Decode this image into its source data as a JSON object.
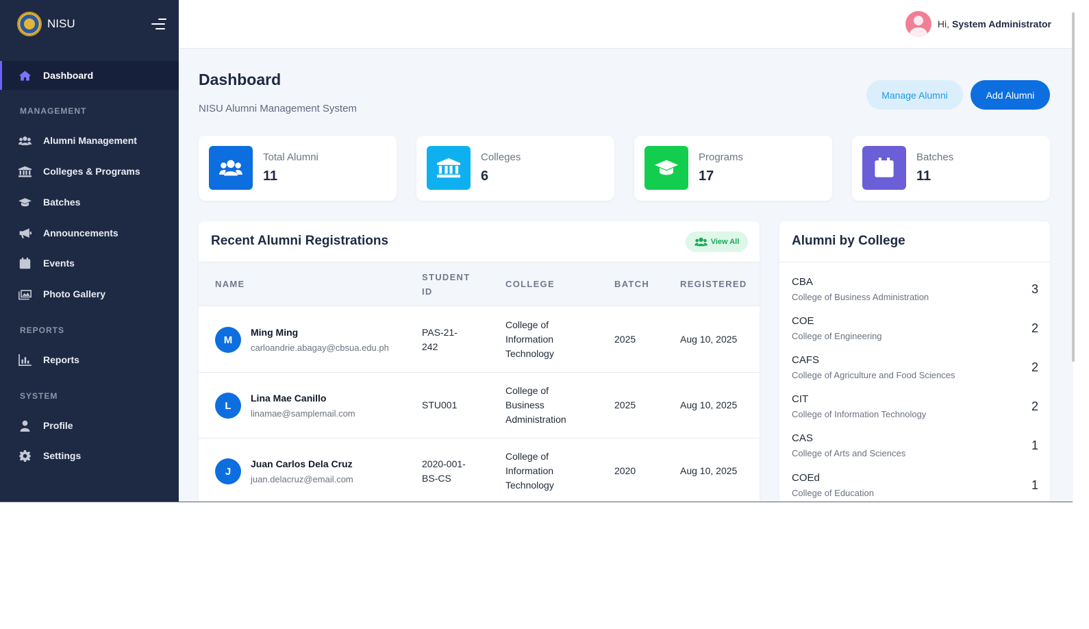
{
  "brand": {
    "name": "NISU"
  },
  "header": {
    "greeting": "Hi,",
    "user_name": "System Administrator"
  },
  "sidebar": {
    "active": "Dashboard",
    "dashboard_label": "Dashboard",
    "sections": {
      "management": "MANAGEMENT",
      "reports": "REPORTS",
      "system": "SYSTEM"
    },
    "items": [
      {
        "label": "Alumni Management",
        "icon": "users-icon"
      },
      {
        "label": "Colleges & Programs",
        "icon": "institution-icon"
      },
      {
        "label": "Batches",
        "icon": "graduation-cap-icon"
      },
      {
        "label": "Announcements",
        "icon": "megaphone-icon"
      },
      {
        "label": "Events",
        "icon": "calendar-icon"
      },
      {
        "label": "Photo Gallery",
        "icon": "images-icon"
      },
      {
        "label": "Reports",
        "icon": "bar-chart-icon"
      },
      {
        "label": "Profile",
        "icon": "user-icon"
      },
      {
        "label": "Settings",
        "icon": "gear-icon"
      }
    ]
  },
  "page": {
    "title": "Dashboard",
    "subtitle": "NISU Alumni Management System",
    "manage_button": "Manage Alumni",
    "add_button": "Add Alumni"
  },
  "stats": [
    {
      "label": "Total Alumni",
      "value": "11",
      "color": "#0d6ee0",
      "icon": "users-icon"
    },
    {
      "label": "Colleges",
      "value": "6",
      "color": "#0fb0ef",
      "icon": "institution-icon"
    },
    {
      "label": "Programs",
      "value": "17",
      "color": "#13ce4e",
      "icon": "graduation-cap-icon"
    },
    {
      "label": "Batches",
      "value": "11",
      "color": "#6a5fd6",
      "icon": "calendar-icon"
    }
  ],
  "recent": {
    "title": "Recent Alumni Registrations",
    "view_all": "View All",
    "headers": {
      "name": "NAME",
      "student_id_1": "STUDENT",
      "student_id_2": "ID",
      "college": "COLLEGE",
      "batch": "BATCH",
      "registered": "REGISTERED"
    },
    "rows": [
      {
        "initial": "M",
        "name": "Ming Ming",
        "email": "carloandrie.abagay@cbsua.edu.ph",
        "sid1": "PAS-21-",
        "sid2": "242",
        "college1": "College of",
        "college2": "Information",
        "college3": "Technology",
        "batch": "2025",
        "registered": "Aug 10, 2025"
      },
      {
        "initial": "L",
        "name": "Lina Mae Canillo",
        "email": "linamae@samplemail.com",
        "sid1": "STU001",
        "sid2": "",
        "college1": "College of",
        "college2": "Business",
        "college3": "Administration",
        "batch": "2025",
        "registered": "Aug 10, 2025"
      },
      {
        "initial": "J",
        "name": "Juan Carlos Dela Cruz",
        "email": "juan.delacruz@email.com",
        "sid1": "2020-001-",
        "sid2": "BS-CS",
        "college1": "College of",
        "college2": "Information",
        "college3": "Technology",
        "batch": "2020",
        "registered": "Aug 10, 2025"
      }
    ]
  },
  "by_college": {
    "title": "Alumni by College",
    "items": [
      {
        "abbr": "CBA",
        "name": "College of Business Administration",
        "count": "3"
      },
      {
        "abbr": "COE",
        "name": "College of Engineering",
        "count": "2"
      },
      {
        "abbr": "CAFS",
        "name": "College of Agriculture and Food Sciences",
        "count": "2"
      },
      {
        "abbr": "CIT",
        "name": "College of Information Technology",
        "count": "2"
      },
      {
        "abbr": "CAS",
        "name": "College of Arts and Sciences",
        "count": "1"
      },
      {
        "abbr": "COEd",
        "name": "College of Education",
        "count": "1"
      }
    ]
  }
}
